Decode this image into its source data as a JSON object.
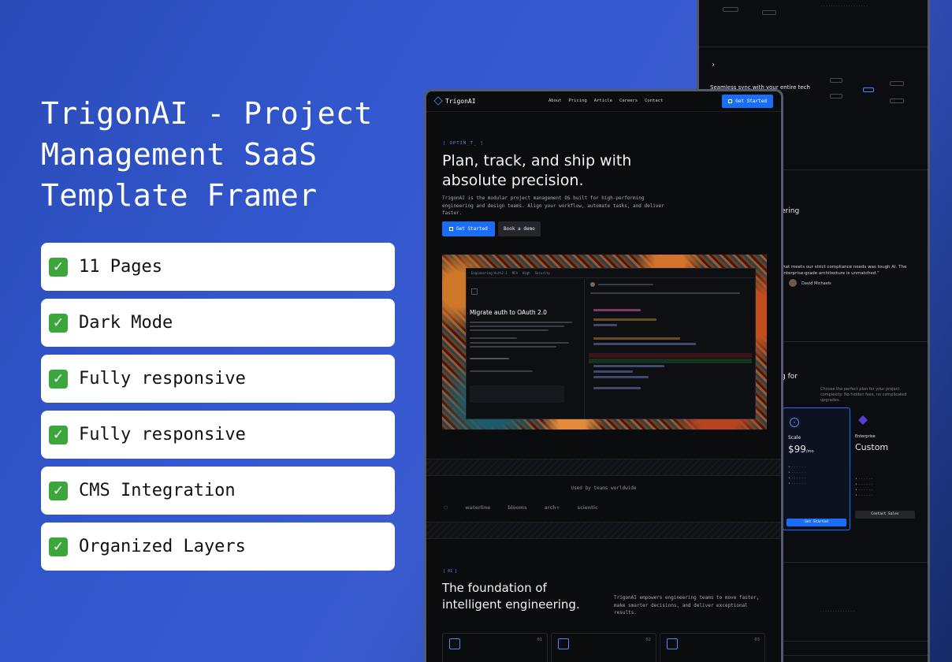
{
  "title": "TrigonAI - Project Management SaaS Template Framer",
  "features": [
    {
      "icon": "check-mark-icon",
      "label": "11 Pages"
    },
    {
      "icon": "check-mark-icon",
      "label": "Dark Mode"
    },
    {
      "icon": "check-mark-icon",
      "label": "Fully responsive"
    },
    {
      "icon": "check-mark-icon",
      "label": "Fully responsive"
    },
    {
      "icon": "check-mark-icon",
      "label": "CMS Integration"
    },
    {
      "icon": "check-mark-icon",
      "label": "Organized Layers"
    }
  ],
  "front": {
    "logo": "TrigonAI",
    "nav": [
      "About",
      "Pricing",
      "Article",
      "Careers",
      "Contact"
    ],
    "nav_cta": "Get Started",
    "tag": "[ OPTIM_T_ ]",
    "hero_title": "Plan, track, and ship with absolute precision.",
    "hero_desc": "TrigonAI is the modular project management OS built for high-performing engineering and design teams. Align your workflow, automate tasks, and deliver faster.",
    "primary_button": "Get Started",
    "secondary_button": "Book a demo",
    "app": {
      "tabs": [
        "Engineering/Auth2.1",
        "MFA",
        "High",
        "Security"
      ],
      "issue_title": "Migrate auth to OAuth 2.0"
    },
    "used_by": "Used by teams worldwide",
    "logos": [
      "waterline",
      "blooms",
      "arch+",
      "scientic"
    ],
    "section_tag": "[ 01 ]",
    "section_title": "The foundation of intelligent engineering.",
    "section_desc": "TrigonAI empowers engineering teams to move faster, make smarter decisions, and deliver exceptional results.",
    "cards": [
      "01",
      "02",
      "03"
    ]
  },
  "back": {
    "sync_title": "Seamless sync with your entire tech",
    "section_heading": "ering",
    "testimonial": "that meets our strict compliance needs was tough AI. The enterprise-grade architecture is unmatched.\"",
    "person": "David Michaels",
    "pricing_heading": "g for",
    "pricing_desc": "Choose the perfect plan for your project complexity. No hidden fees, no complicated upgrades.",
    "plans": [
      {
        "name": "Scale",
        "price": "$99",
        "period": "/mo",
        "cta": "Get Started"
      },
      {
        "name": "Enterprise",
        "price": "Custom",
        "cta": "Contact Sales"
      }
    ]
  }
}
